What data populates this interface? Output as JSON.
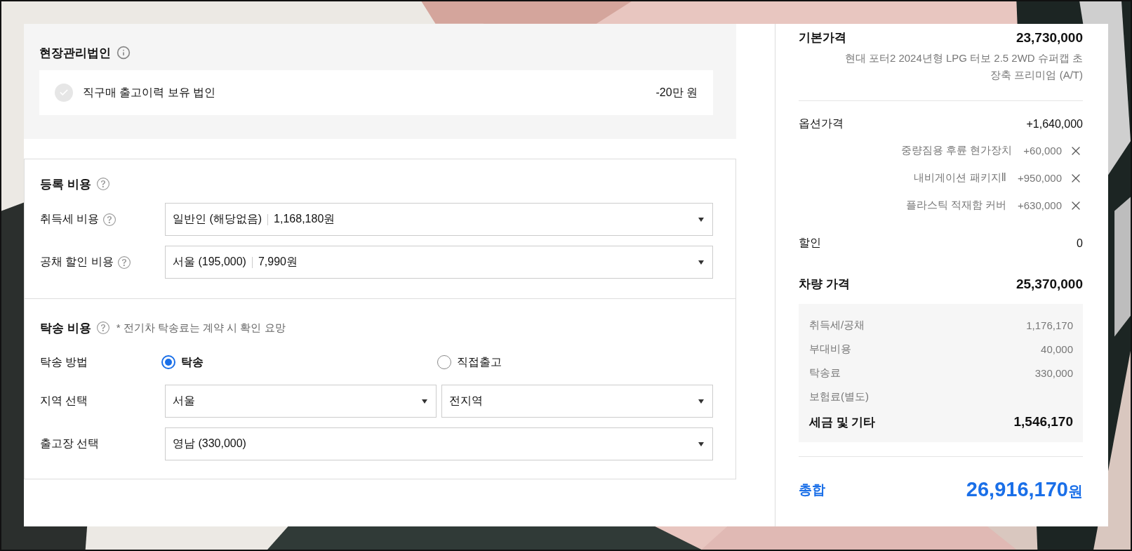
{
  "corporate": {
    "title": "현장관리법인",
    "option": {
      "label": "직구매 출고이력 보유 법인",
      "amount": "-20만 원",
      "checked": false
    }
  },
  "registration": {
    "title": "등록 비용",
    "fields": [
      {
        "label": "취득세 비용",
        "value": "일반인 (해당없음)",
        "amount": "1,168,180원"
      },
      {
        "label": "공채 할인 비용",
        "value": "서울 (195,000)",
        "amount": "7,990원"
      }
    ]
  },
  "delivery": {
    "title": "탁송 비용",
    "note": "* 전기차 탁송료는 계약 시 확인 요망",
    "method_label": "탁송 방법",
    "methods": [
      {
        "label": "탁송",
        "selected": true
      },
      {
        "label": "직접출고",
        "selected": false
      }
    ],
    "region": {
      "label": "지역 선택",
      "values": [
        "서울",
        "전지역"
      ]
    },
    "depot": {
      "label": "출고장 선택",
      "value": "영남 (330,000)"
    }
  },
  "summary": {
    "base": {
      "label": "기본가격",
      "amount": "23,730,000",
      "description": "현대 포터2 2024년형 LPG 터보 2.5 2WD 슈퍼캡 초장축 프리미엄 (A/T)"
    },
    "options": {
      "label": "옵션가격",
      "amount": "+1,640,000",
      "items": [
        {
          "name": "중량짐용 후륜 현가장치",
          "amount": "+60,000"
        },
        {
          "name": "내비게이션 패키지Ⅱ",
          "amount": "+950,000"
        },
        {
          "name": "플라스틱 적재함 커버",
          "amount": "+630,000"
        }
      ]
    },
    "discount": {
      "label": "할인",
      "amount": "0"
    },
    "vehicle": {
      "label": "차량 가격",
      "amount": "25,370,000"
    },
    "fees": {
      "rows": [
        {
          "label": "취득세/공채",
          "amount": "1,176,170"
        },
        {
          "label": "부대비용",
          "amount": "40,000"
        },
        {
          "label": "탁송료",
          "amount": "330,000"
        },
        {
          "label": "보험료(별도)"
        }
      ],
      "total": {
        "label": "세금 및 기타",
        "amount": "1,546,170"
      }
    },
    "grand_total": {
      "label": "총합",
      "amount": "26,916,170",
      "unit": "원"
    }
  }
}
